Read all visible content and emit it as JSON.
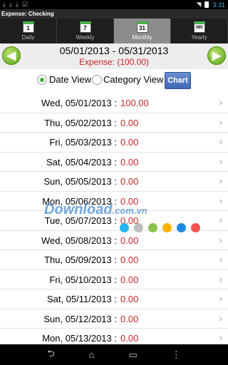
{
  "status": {
    "time": "3:31"
  },
  "app": {
    "title": "Expense: Checking"
  },
  "tabs": [
    {
      "label": "Daily",
      "cal": "1"
    },
    {
      "label": "Weekly",
      "cal": "7"
    },
    {
      "label": "Monthly",
      "cal": "31"
    },
    {
      "label": "Yearly",
      "cal": "365"
    }
  ],
  "header": {
    "range": "05/01/2013 - 05/31/2013",
    "expense": "Expense: (100.00)"
  },
  "view": {
    "date_label": "Date View",
    "category_label": "Category View",
    "chart_label": "Chart"
  },
  "rows": [
    {
      "date": "Wed, 05/01/2013 :",
      "amount": "100.00"
    },
    {
      "date": "Thu, 05/02/2013 :",
      "amount": "0.00"
    },
    {
      "date": "Fri, 05/03/2013 :",
      "amount": "0.00"
    },
    {
      "date": "Sat, 05/04/2013 :",
      "amount": "0.00"
    },
    {
      "date": "Sun, 05/05/2013 :",
      "amount": "0.00"
    },
    {
      "date": "Mon, 05/06/2013 :",
      "amount": "0.00"
    },
    {
      "date": "Tue, 05/07/2013 :",
      "amount": "0.00"
    },
    {
      "date": "Wed, 05/08/2013 :",
      "amount": "0.00"
    },
    {
      "date": "Thu, 05/09/2013 :",
      "amount": "0.00"
    },
    {
      "date": "Fri, 05/10/2013 :",
      "amount": "0.00"
    },
    {
      "date": "Sat, 05/11/2013 :",
      "amount": "0.00"
    },
    {
      "date": "Sun, 05/12/2013 :",
      "amount": "0.00"
    },
    {
      "date": "Mon, 05/13/2013 :",
      "amount": "0.00"
    }
  ],
  "watermark": {
    "text": "Download",
    "suffix": ".com.vn"
  },
  "colors": {
    "accent_green": "#5ea318",
    "expense_red": "#c62828",
    "chart_blue": "#3f67b5"
  },
  "dot_colors": [
    "#29b6f6",
    "#bdbdbd",
    "#8bc34a",
    "#ffb300",
    "#1e88e5",
    "#ef5350"
  ]
}
